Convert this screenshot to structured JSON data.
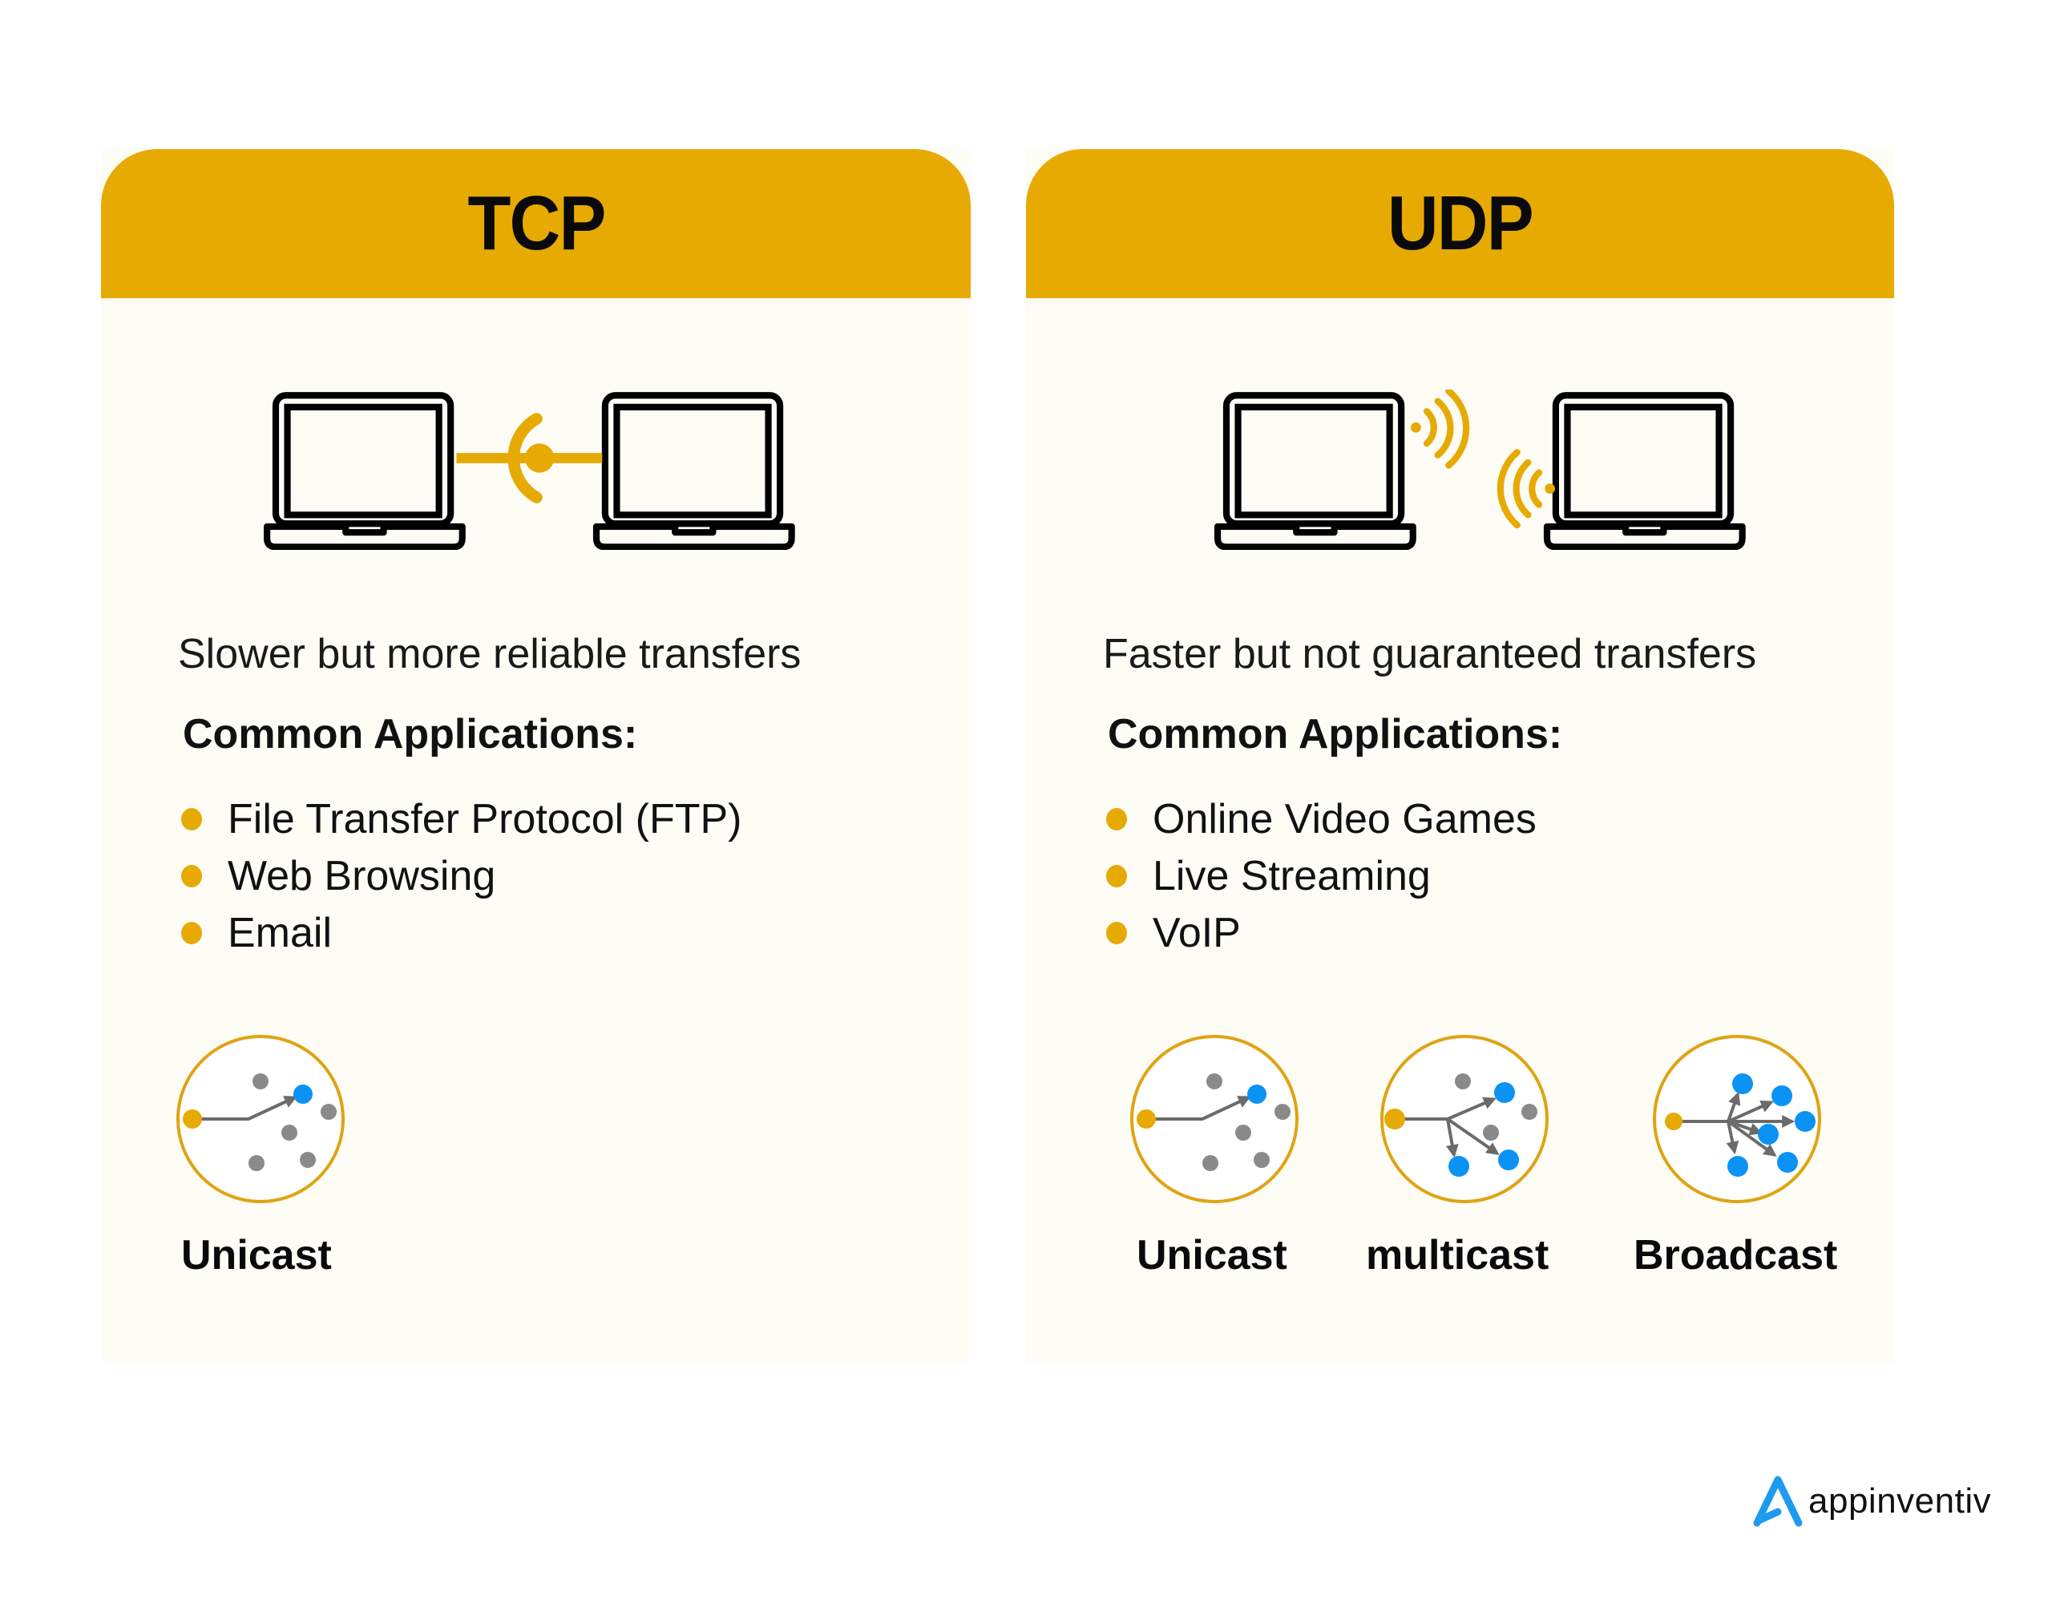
{
  "colors": {
    "accent": "#e6aa03",
    "card_bg": "#fdfcf5",
    "node_blue": "#0a93f5",
    "node_gray": "#8a8a8a",
    "arrow": "#6b6b6b",
    "logo_blue": "#1e9af0"
  },
  "tcp": {
    "title": "TCP",
    "illustration": "laptops-connected-icon",
    "description": "Slower but more reliable transfers",
    "apps_heading": "Common Applications:",
    "apps": [
      "File Transfer Protocol (FTP)",
      "Web Browsing",
      "Email"
    ],
    "cast_types": [
      {
        "label": "Unicast",
        "icon": "unicast-icon"
      }
    ]
  },
  "udp": {
    "title": "UDP",
    "illustration": "laptops-wireless-icon",
    "description": "Faster but not guaranteed transfers",
    "apps_heading": "Common Applications:",
    "apps": [
      "Online Video Games",
      "Live Streaming",
      "VoIP"
    ],
    "cast_types": [
      {
        "label": "Unicast",
        "icon": "unicast-icon"
      },
      {
        "label": "multicast",
        "icon": "multicast-icon"
      },
      {
        "label": "Broadcast",
        "icon": "broadcast-icon"
      }
    ]
  },
  "logo": {
    "text": "appinventiv"
  }
}
